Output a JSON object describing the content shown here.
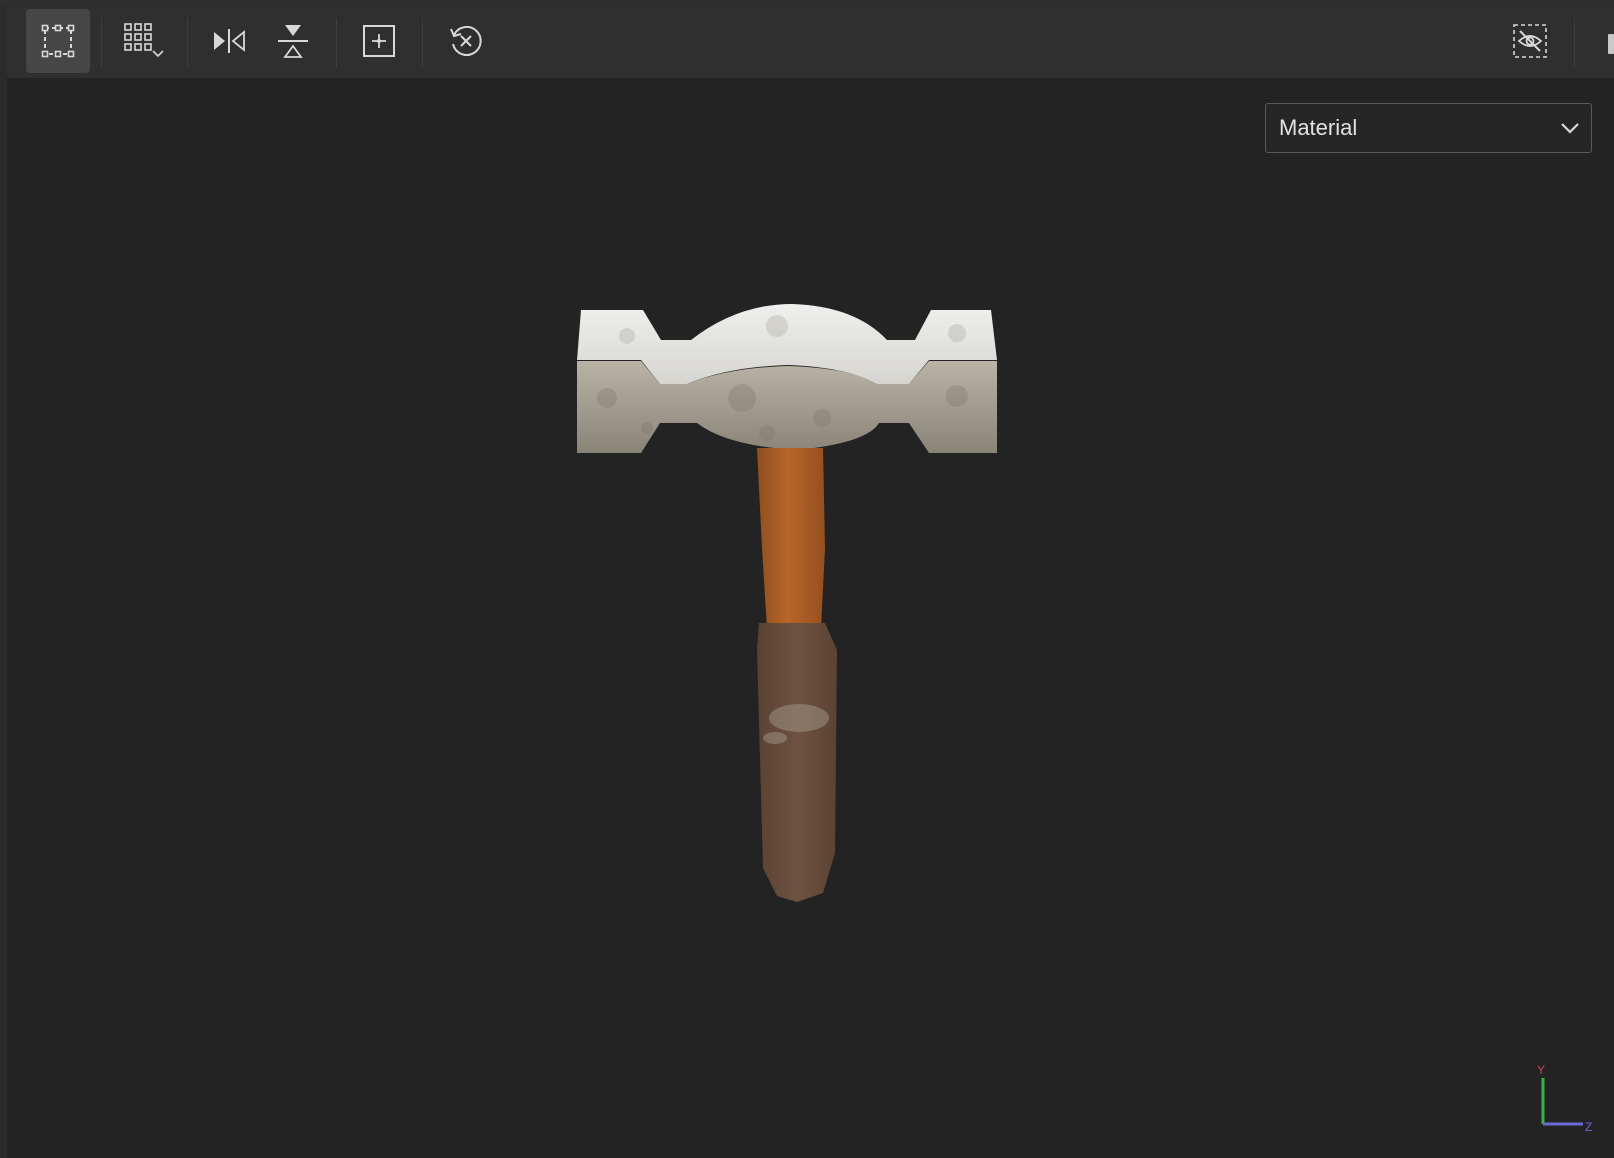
{
  "toolbar": {
    "buttons": [
      {
        "name": "select-frame",
        "icon": "frame-select-icon",
        "active": true
      },
      {
        "name": "grid-options",
        "icon": "grid-dropdown-icon",
        "active": false
      },
      {
        "name": "mirror-horizontal",
        "icon": "mirror-horizontal-icon",
        "active": false
      },
      {
        "name": "mirror-vertical",
        "icon": "mirror-vertical-icon",
        "active": false
      },
      {
        "name": "add-point",
        "icon": "add-point-icon",
        "active": false
      },
      {
        "name": "reset-view",
        "icon": "reset-view-icon",
        "active": false
      },
      {
        "name": "toggle-visibility",
        "icon": "hidden-eye-icon",
        "active": false
      }
    ]
  },
  "viewport": {
    "render_mode": {
      "selected": "Material"
    },
    "axes": {
      "y_label": "Y",
      "z_label": "Z"
    }
  },
  "colors": {
    "background": "#232323",
    "toolbar": "#2f2f2f",
    "icon": "#d8d8d8",
    "axis_y": "#35b34a",
    "axis_z": "#6a6ad6"
  }
}
